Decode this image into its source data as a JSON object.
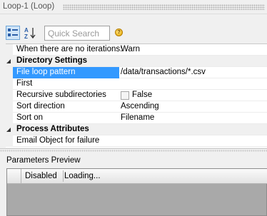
{
  "window": {
    "title": "Loop-1 (Loop)"
  },
  "toolbar": {
    "search_placeholder": "Quick Search",
    "help_glyph": "?"
  },
  "properties": {
    "top_row": {
      "name": "When there are no iterations:",
      "value": "Warn"
    },
    "directory_settings": {
      "label": "Directory Settings",
      "rows": [
        {
          "name": "File loop pattern",
          "value": "/data/transactions/*.csv"
        },
        {
          "name": "First",
          "value": ""
        },
        {
          "name": "Recursive subdirectories",
          "value": "False"
        },
        {
          "name": "Sort direction",
          "value": "Ascending"
        },
        {
          "name": "Sort on",
          "value": "Filename"
        }
      ]
    },
    "process_attributes": {
      "label": "Process Attributes",
      "rows": [
        {
          "name": "Email Object for failure",
          "value": ""
        }
      ]
    }
  },
  "preview": {
    "label": "Parameters Preview",
    "columns": [
      "Disabled",
      "Loading..."
    ]
  },
  "colors": {
    "selection": "#3399ff",
    "preview_background": "#a9a9a9"
  }
}
